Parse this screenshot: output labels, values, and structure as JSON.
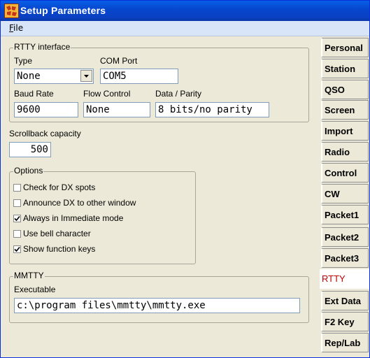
{
  "window": {
    "title": "Setup Parameters"
  },
  "menu": {
    "file_label": "F",
    "file_rest": "ile"
  },
  "rtty_interface": {
    "legend": "RTTY interface",
    "type_label": "Type",
    "type_value": "None",
    "com_port_label": "COM Port",
    "com_port_value": "COM5",
    "baud_rate_label": "Baud Rate",
    "baud_rate_value": "9600",
    "flow_control_label": "Flow Control",
    "flow_control_value": "None",
    "data_parity_label": "Data / Parity",
    "data_parity_value": "8 bits/no parity"
  },
  "scrollback": {
    "label": "Scrollback capacity",
    "value": "500"
  },
  "options": {
    "legend": "Options",
    "items": [
      {
        "label": "Check for DX spots",
        "checked": false
      },
      {
        "label": "Announce DX to other window",
        "checked": false
      },
      {
        "label": "Always in Immediate mode",
        "checked": true
      },
      {
        "label": "Use bell character",
        "checked": false
      },
      {
        "label": "Show function keys",
        "checked": true
      }
    ]
  },
  "mmtty": {
    "legend": "MMTTY",
    "executable_label": "Executable",
    "executable_value": "c:\\program files\\mmtty\\mmtty.exe"
  },
  "tabs": [
    {
      "label": "Personal",
      "active": false
    },
    {
      "label": "Station",
      "active": false
    },
    {
      "label": "QSO",
      "active": false
    },
    {
      "label": "Screen",
      "active": false
    },
    {
      "label": "Import",
      "active": false
    },
    {
      "label": "Radio",
      "active": false
    },
    {
      "label": "Control",
      "active": false
    },
    {
      "label": "CW",
      "active": false
    },
    {
      "label": "Packet1",
      "active": false
    },
    {
      "label": "Packet2",
      "active": false
    },
    {
      "label": "Packet3",
      "active": false
    },
    {
      "label": "RTTY",
      "active": true
    },
    {
      "label": "Ext Data",
      "active": false
    },
    {
      "label": "F2 Key",
      "active": false
    },
    {
      "label": "Rep/Lab",
      "active": false
    }
  ]
}
